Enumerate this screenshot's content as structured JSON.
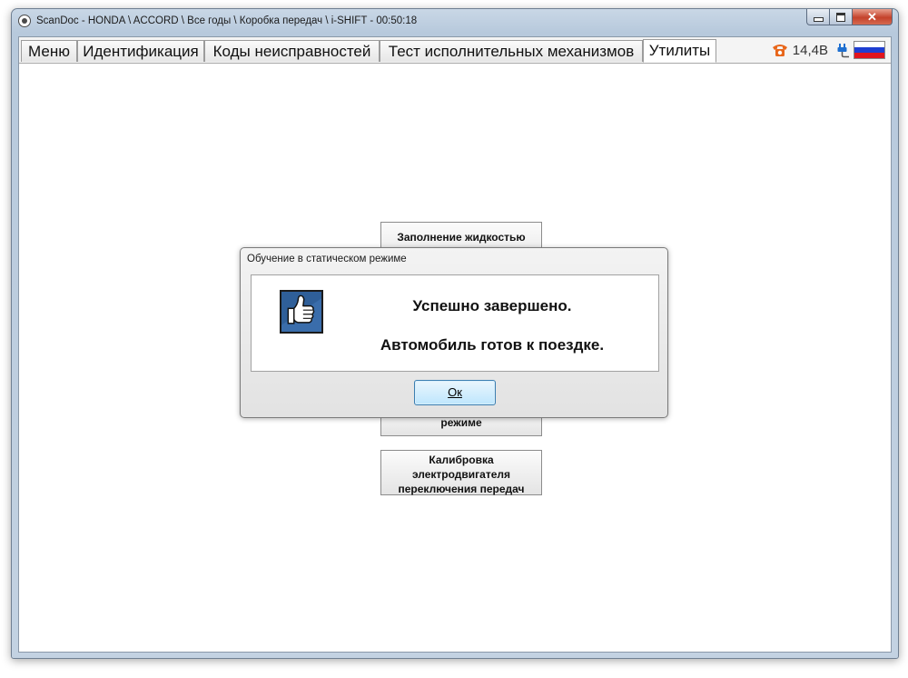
{
  "window": {
    "title": "ScanDoc - HONDA \\ ACCORD \\ Все годы \\ Коробка передач \\ i-SHIFT - 00:50:18",
    "close_glyph": "✕"
  },
  "tabs": [
    {
      "label": "Меню"
    },
    {
      "label": "Идентификация"
    },
    {
      "label": "Коды неисправностей"
    },
    {
      "label": "Тест исполнительных механизмов"
    },
    {
      "label": "Утилиты",
      "active": true
    }
  ],
  "status": {
    "voltage": "14,4В",
    "icons": [
      "phone-icon",
      "plug-icon",
      "flag-russia-icon"
    ],
    "flag_colors": [
      "#ffffff",
      "#1f3fd1",
      "#e0141e"
    ]
  },
  "background_buttons": {
    "fill": "Заполнение жидкостью",
    "static_fragment": "режиме",
    "calibration": [
      "Калибровка",
      "электродвигателя",
      "переключения передач"
    ]
  },
  "dialog": {
    "title": "Обучение в статическом режиме",
    "line1": "Успешно завершено.",
    "line2": "Автомобиль готов к поездке.",
    "ok": "Ок",
    "icon": "thumbs-up-icon"
  },
  "colors": {
    "accent": "#2f5f99",
    "phone": "#e8661a"
  }
}
